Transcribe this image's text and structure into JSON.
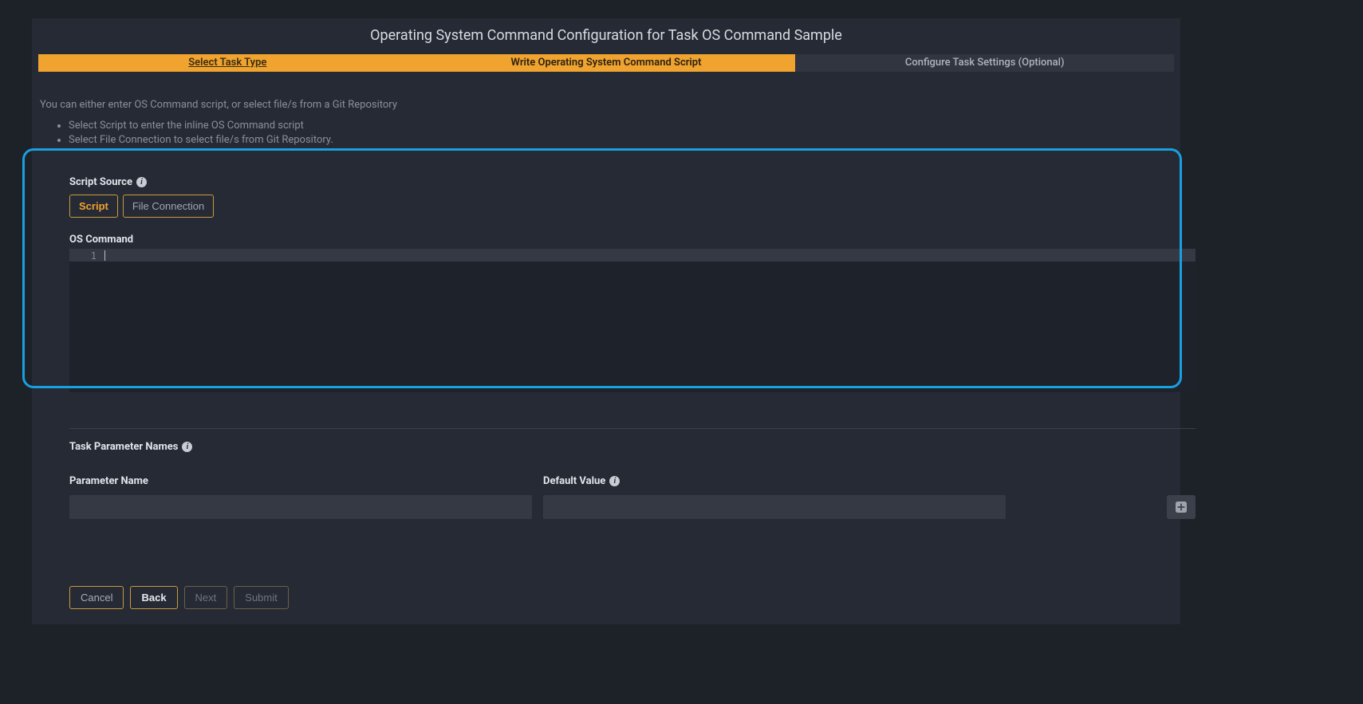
{
  "page_title": "Operating System Command Configuration for Task OS Command Sample",
  "wizard": {
    "tab1": "Select Task Type",
    "tab2": "Write Operating System Command Script",
    "tab3": "Configure Task Settings (Optional)"
  },
  "intro": "You can either enter OS Command script, or select file/s from a Git Repository",
  "bullets": {
    "b1": "Select Script to enter the inline OS Command script",
    "b2": "Select File Connection to select file/s from Git Repository."
  },
  "script_source": {
    "label": "Script Source",
    "option_script": "Script",
    "option_file": "File Connection"
  },
  "os_command": {
    "label": "OS Command",
    "line_number": "1",
    "content": ""
  },
  "task_params": {
    "label": "Task Parameter Names",
    "col_name": "Parameter Name",
    "col_default": "Default Value",
    "name_value": "",
    "default_value": ""
  },
  "footer": {
    "cancel": "Cancel",
    "back": "Back",
    "next": "Next",
    "submit": "Submit"
  },
  "icons": {
    "info": "i"
  }
}
